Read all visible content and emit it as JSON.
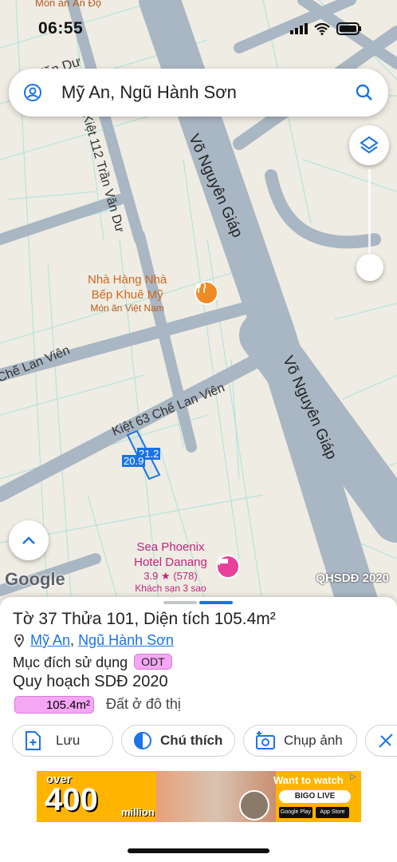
{
  "status": {
    "time": "06:55"
  },
  "search": {
    "query": "Mỹ An, Ngũ Hành Sơn"
  },
  "map": {
    "top_label": "Món ăn Ấn Độ",
    "streets": {
      "tran_van_du_top": "n Văn Dư",
      "kiet_112": "Kiệt 112 Trần Văn Dư",
      "vo_nguyen_giap_1": "Võ Nguyên Giáp",
      "vo_nguyen_giap_2": "Võ Nguyên Giáp",
      "che_lan_vien_left": "Chế Lan Viên",
      "kiet_63": "Kiệt 63 Chế Lan Viên"
    },
    "poi_restaurant": {
      "name_line1": "Nhà Hàng Nhà",
      "name_line2": "Bếp Khuê Mỹ",
      "category": "Món ăn Việt Nam"
    },
    "poi_hotel": {
      "name_line1": "Sea Phoenix",
      "name_line2": "Hotel Danang",
      "rating": "3.9",
      "reviews": "(578)",
      "category": "Khách sạn 3 sao"
    },
    "parcel": {
      "dim_a": "21.2",
      "dim_b": "20.9"
    },
    "google_logo": "Google",
    "layer_label": "QHSDĐ 2020"
  },
  "sheet": {
    "title": "Tờ 37 Thửa 101, Diện tích 105.4m²",
    "address_ward": "Mỹ An",
    "address_sep": ",",
    "address_district": "Ngũ Hành Sơn",
    "purpose_label": "Mục đích sử dụng",
    "purpose_code": "ODT",
    "plan_label": "Quy hoạch SDĐ 2020",
    "plan_area": "105.4m²",
    "plan_desc": "Đất ở đô thị",
    "buttons": {
      "save": "Lưu",
      "legend": "Chú thích",
      "photo": "Chụp ảnh"
    }
  },
  "ad": {
    "over": "over",
    "number": "400",
    "million": "million users",
    "cta": "Want to watch",
    "brand": "BIGO LIVE",
    "store1": "Google Play",
    "store2": "App Store"
  },
  "colors": {
    "accent": "#1a73e8",
    "road": "#a9b6c3",
    "map_bg": "#efece3",
    "parcel_line": "#9fe3de",
    "badge": "#f5a6f5"
  }
}
